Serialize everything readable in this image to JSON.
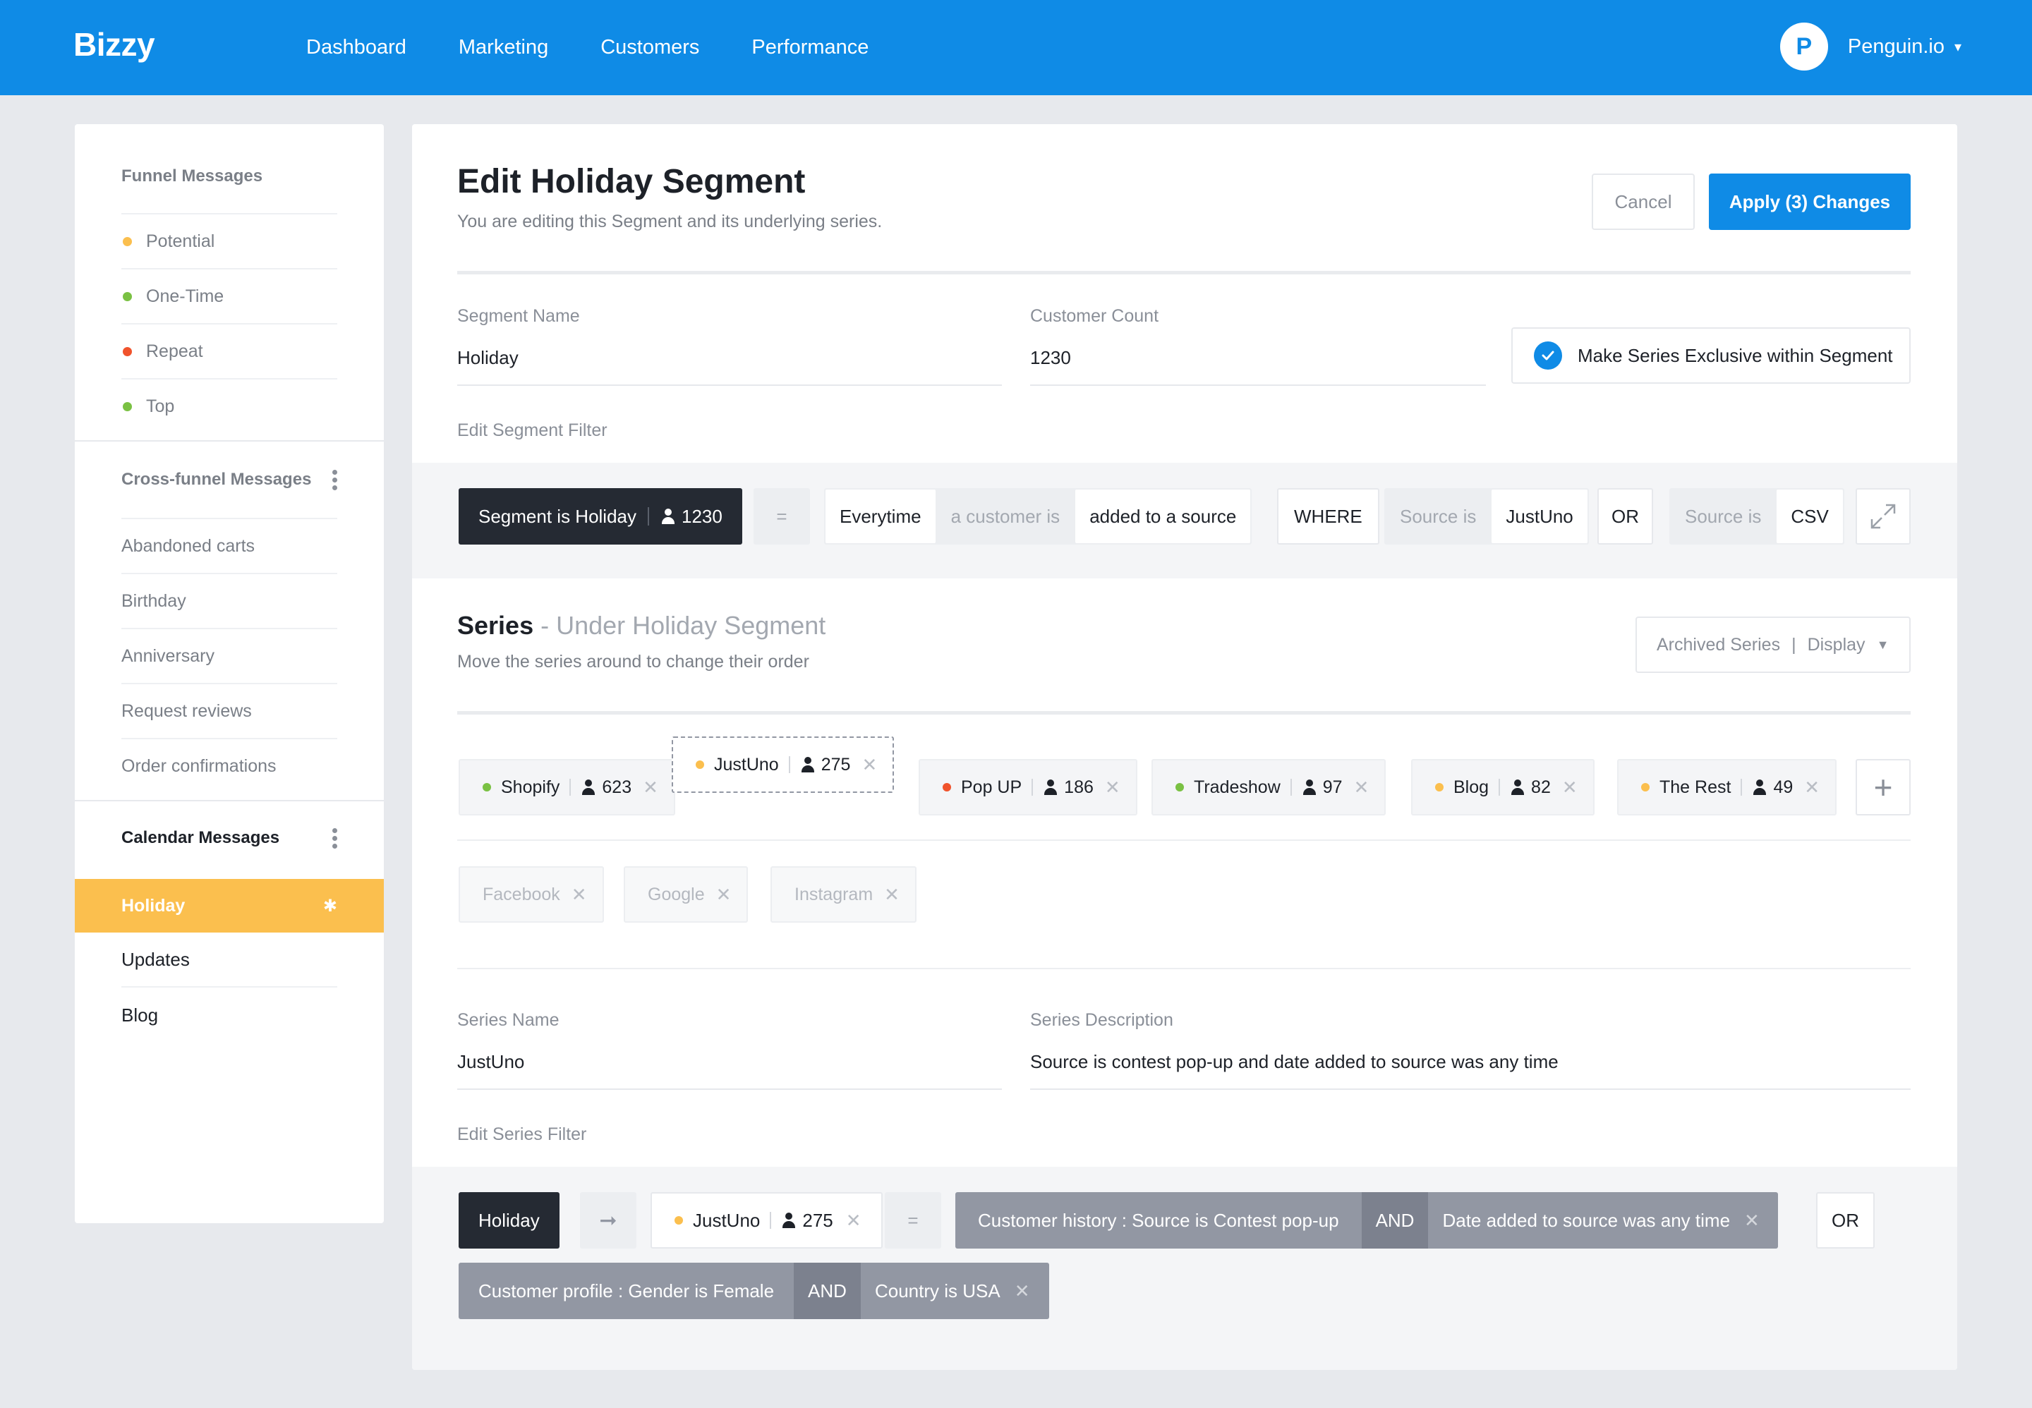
{
  "app": {
    "logo": "Bizzy"
  },
  "nav": {
    "items": [
      "Dashboard",
      "Marketing",
      "Customers",
      "Performance"
    ]
  },
  "account": {
    "initial": "P",
    "name": "Penguin.io",
    "caret": "▾"
  },
  "sidebar": {
    "funnel": {
      "heading": "Funnel Messages",
      "items": [
        {
          "label": "Potential",
          "color": "#fbbf4e"
        },
        {
          "label": "One-Time",
          "color": "#7ac143"
        },
        {
          "label": "Repeat",
          "color": "#f0532c"
        },
        {
          "label": "Top",
          "color": "#7ac143"
        }
      ]
    },
    "cross": {
      "heading": "Cross-funnel Messages",
      "items": [
        "Abandoned carts",
        "Birthday",
        "Anniversary",
        "Request reviews",
        "Order confirmations"
      ]
    },
    "calendar": {
      "heading": "Calendar Messages",
      "active": "Holiday",
      "items": [
        "Updates",
        "Blog"
      ]
    }
  },
  "page": {
    "title": "Edit Holiday Segment",
    "subtitle": "You are editing this Segment and its underlying series.",
    "cancel_label": "Cancel",
    "apply_label": "Apply (3) Changes"
  },
  "segment": {
    "name_label": "Segment Name",
    "name_value": "Holiday",
    "count_label": "Customer Count",
    "count_value": "1230",
    "exclusive_label": "Make Series Exclusive within Segment",
    "filter_label": "Edit Segment Filter",
    "filter": {
      "segment_chip": "Segment is Holiday",
      "segment_count": "1230",
      "equals": "=",
      "everytime": "Everytime",
      "customer_is": "a customer is",
      "added": "added to a source",
      "where": "WHERE",
      "source_is_1": "Source is",
      "source_val_1": "JustUno",
      "or": "OR",
      "source_is_2": "Source is",
      "source_val_2": "CSV"
    }
  },
  "series": {
    "title": "Series",
    "title_suffix": " - Under Holiday Segment",
    "subtitle": "Move the series around to change their order",
    "archived_label": "Archived Series",
    "archived_sep": "|",
    "display_label": "Display",
    "tags": [
      {
        "label": "Shopify",
        "count": "623",
        "color": "#7ac143"
      },
      {
        "label": "JustUno",
        "count": "275",
        "color": "#fbbf4e"
      },
      {
        "label": "Pop UP",
        "count": "186",
        "color": "#f0532c"
      },
      {
        "label": "Tradeshow",
        "count": "97",
        "color": "#7ac143"
      },
      {
        "label": "Blog",
        "count": "82",
        "color": "#fbbf4e"
      },
      {
        "label": "The Rest",
        "count": "49",
        "color": "#fbbf4e"
      }
    ],
    "muted_tags": [
      "Facebook",
      "Google",
      "Instagram"
    ],
    "name_label": "Series Name",
    "name_value": "JustUno",
    "desc_label": "Series Description",
    "desc_value": "Source is contest pop-up and date added to source was any time",
    "filter_label": "Edit Series Filter",
    "filter": {
      "holiday": "Holiday",
      "arrow": "➞",
      "series_label": "JustUno",
      "series_count": "275",
      "equals": "=",
      "cond1": "Customer history : Source is Contest pop-up",
      "and1": "AND",
      "cond2": "Date added to source was any time",
      "or": "OR",
      "cond3": "Customer profile : Gender is Female",
      "and2": "AND",
      "cond4": "Country is USA"
    }
  }
}
